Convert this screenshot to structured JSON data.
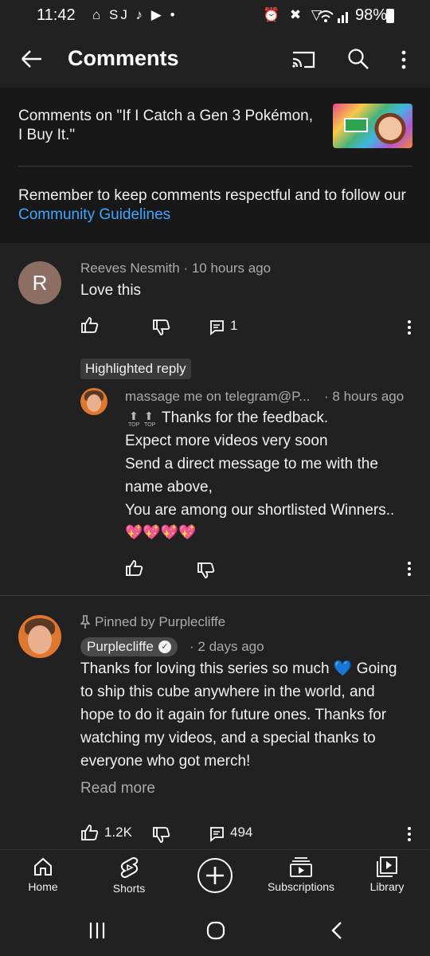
{
  "status": {
    "time": "11:42",
    "left_icons": "⌂ SJ ♪ ▶ •",
    "right_icons": "⏰ ✖ ▽",
    "battery": "98%"
  },
  "topbar": {
    "title": "Comments"
  },
  "header": {
    "video_line": "Comments on \"If I Catch a Gen 3 Pokémon, I Buy It.\"",
    "rules_text": "Remember to keep comments respectful and to follow our ",
    "rules_link": "Community Guidelines"
  },
  "comment1": {
    "avatar_letter": "R",
    "author": "Reeves Nesmith",
    "time": "10 hours ago",
    "text": "Love this",
    "reply_count": "1"
  },
  "highlighted_label": "Highlighted reply",
  "reply": {
    "author": "massage me on telegram@P...",
    "time": "8 hours ago",
    "line1": "Thanks for the feedback.",
    "line2": "Expect more videos very soon",
    "line3": "Send a direct message to  me with the",
    "line4": "name above,",
    "line5": "You are among our shortlisted Winners..",
    "hearts": "💖💖💖💖",
    "top_label": "TOP"
  },
  "comment2": {
    "pinned_label": "Pinned by Purplecliffe",
    "author": "Purplecliffe",
    "time": "2 days ago",
    "line1": "Thanks for loving this series so much 💙 Going",
    "line2": "to ship this cube anywhere in the world, and",
    "line3": "hope to do it again for future ones. Thanks for",
    "line4": "watching my videos, and a special thanks to",
    "line5": "everyone who got merch!",
    "read_more": "Read more",
    "likes": "1.2K",
    "replies": "494"
  },
  "nav": {
    "home": "Home",
    "shorts": "Shorts",
    "subscriptions": "Subscriptions",
    "library": "Library"
  },
  "colors": {
    "background": "#212121",
    "header_bg": "#181818",
    "link": "#3ea6ff",
    "muted": "#aaaaaa"
  }
}
